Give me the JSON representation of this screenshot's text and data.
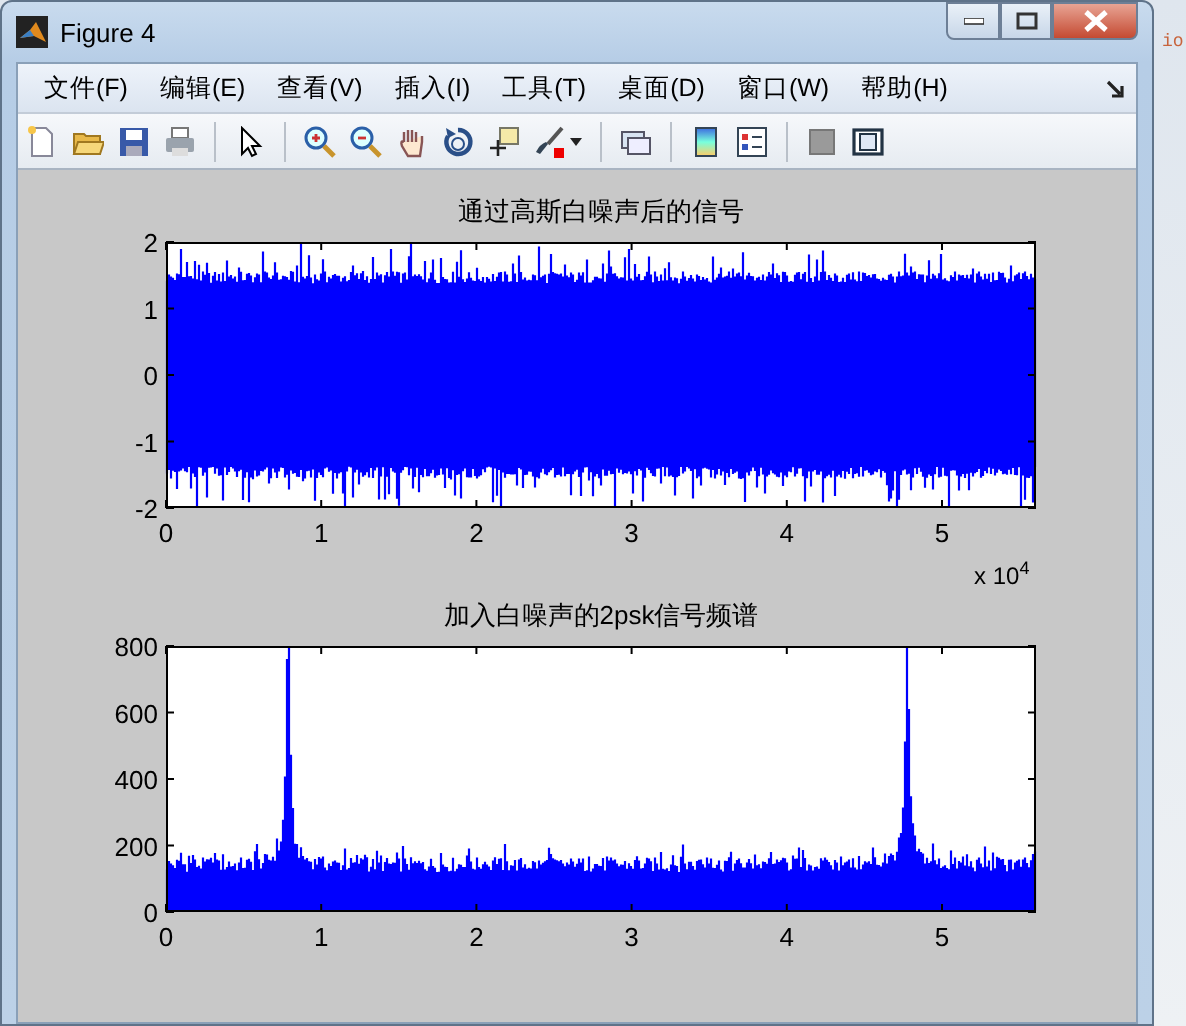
{
  "window": {
    "title": "Figure 4"
  },
  "menu": [
    "文件(F)",
    "编辑(E)",
    "查看(V)",
    "插入(I)",
    "工具(T)",
    "桌面(D)",
    "窗口(W)",
    "帮助(H)"
  ],
  "plots": [
    {
      "kind": "signal",
      "title": "通过高斯白噪声后的信号",
      "y_tick_labels": [
        "2",
        "1",
        "0",
        "-1",
        "-2"
      ],
      "x_tick_labels": [
        "0",
        "1",
        "2",
        "3",
        "4",
        "5"
      ],
      "x_exponent": "x 10$^{4}$"
    },
    {
      "kind": "spectrum",
      "title": "加入白噪声的2psk信号频谱",
      "y_tick_labels": [
        "800",
        "600",
        "400",
        "200",
        "0"
      ],
      "x_tick_labels": [
        "0",
        "1",
        "2",
        "3",
        "4",
        "5"
      ]
    }
  ],
  "background_window": {
    "text": "io"
  }
}
